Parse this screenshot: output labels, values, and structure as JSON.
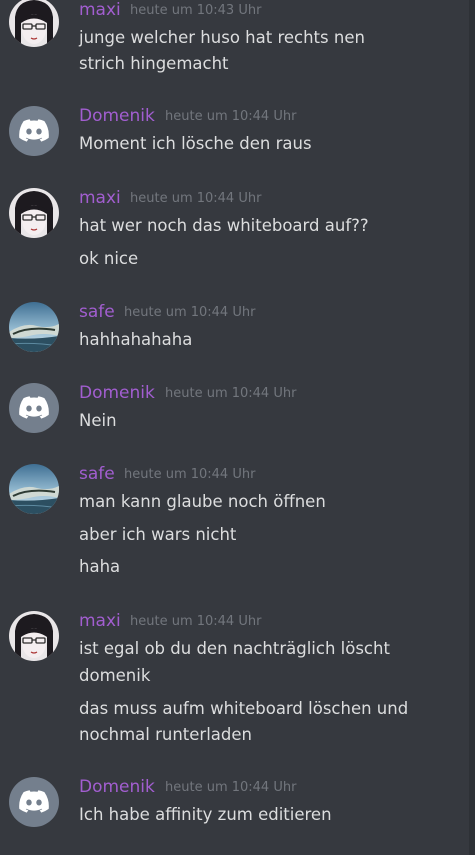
{
  "colors": {
    "background": "#36393f",
    "text": "#dcddde",
    "timestamp": "#72767d",
    "username": "#a25ed0",
    "discord_avatar_bg": "#747f8d"
  },
  "messages": [
    {
      "author": "maxi",
      "avatar": "anime-girl-avatar",
      "timestamp": "heute um 10:43 Uhr",
      "lines": [
        "junge welcher huso hat rechts nen",
        "strich hingemacht"
      ]
    },
    {
      "author": "Domenik",
      "avatar": "discord-logo-avatar",
      "timestamp": "heute um 10:44 Uhr",
      "lines": [
        "Moment ich lösche den raus"
      ]
    },
    {
      "author": "maxi",
      "avatar": "anime-girl-avatar",
      "timestamp": "heute um 10:44 Uhr",
      "lines": [
        "hat wer noch das whiteboard auf??",
        "ok nice"
      ]
    },
    {
      "author": "safe",
      "avatar": "landscape-avatar",
      "timestamp": "heute um 10:44 Uhr",
      "lines": [
        "hahhahahaha"
      ]
    },
    {
      "author": "Domenik",
      "avatar": "discord-logo-avatar",
      "timestamp": "heute um 10:44 Uhr",
      "lines": [
        "Nein"
      ]
    },
    {
      "author": "safe",
      "avatar": "landscape-avatar",
      "timestamp": "heute um 10:44 Uhr",
      "lines": [
        "man kann glaube noch öffnen",
        "aber ich wars nicht",
        "haha"
      ]
    },
    {
      "author": "maxi",
      "avatar": "anime-girl-avatar",
      "timestamp": "heute um 10:44 Uhr",
      "lines": [
        "ist egal ob du den nachträglich löscht",
        "domenik",
        "das muss aufm whiteboard löschen und",
        "nochmal runterladen"
      ]
    },
    {
      "author": "Domenik",
      "avatar": "discord-logo-avatar",
      "timestamp": "heute um 10:44 Uhr",
      "lines": [
        "Ich habe affinity zum editieren"
      ]
    }
  ]
}
